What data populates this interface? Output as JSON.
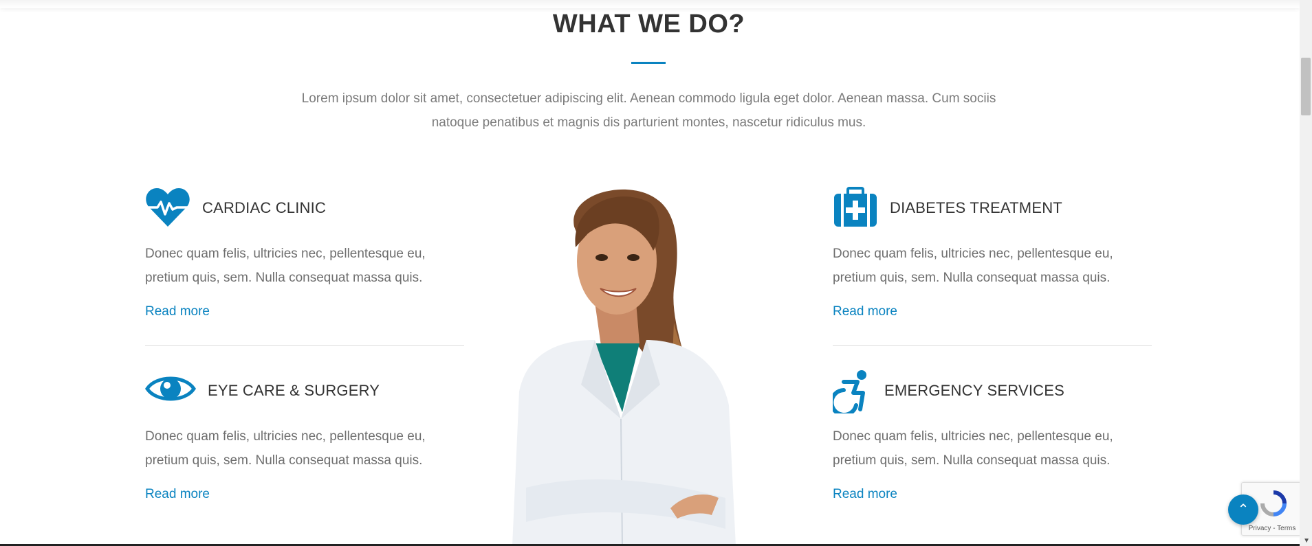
{
  "section": {
    "title": "WHAT WE DO?",
    "intro": "Lorem ipsum dolor sit amet, consectetuer adipiscing elit. Aenean commodo ligula eget dolor. Aenean massa. Cum sociis natoque penatibus et magnis dis parturient montes, nascetur ridiculus mus.",
    "accent_color": "#0a83c0"
  },
  "services": [
    {
      "icon": "heartbeat-icon",
      "name": "CARDIAC CLINIC",
      "description": "Donec quam felis, ultricies nec, pellentesque eu, pretium quis, sem. Nulla consequat massa quis.",
      "link": "Read more"
    },
    {
      "icon": "eye-icon",
      "name": "EYE CARE & SURGERY",
      "description": "Donec quam felis, ultricies nec, pellentesque eu, pretium quis, sem. Nulla consequat massa quis.",
      "link": "Read more"
    },
    {
      "icon": "medical-kit-icon",
      "name": "DIABETES TREATMENT",
      "description": "Donec quam felis, ultricies nec, pellentesque eu, pretium quis, sem. Nulla consequat massa quis.",
      "link": "Read more"
    },
    {
      "icon": "wheelchair-icon",
      "name": "EMERGENCY SERVICES",
      "description": "Donec quam felis, ultricies nec, pellentesque eu, pretium quis, sem. Nulla consequat massa quis.",
      "link": "Read more"
    }
  ],
  "recaptcha": {
    "links": "Privacy - Terms"
  },
  "back_to_top": {
    "icon": "chevron-up-icon"
  }
}
